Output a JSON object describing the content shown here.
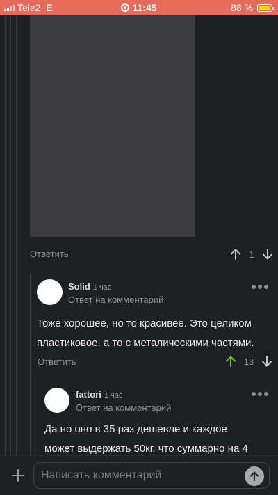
{
  "status_bar": {
    "carrier": "Tele2",
    "network": "E",
    "time": "11:45",
    "battery": "88 %",
    "battery_level": 0.88
  },
  "thread": {
    "top_post": {
      "reply_label": "Ответить",
      "vote_count": "1"
    },
    "comments": [
      {
        "author": "Solid",
        "time": "1 час",
        "subtitle": "Ответ на комментарий",
        "lines": [
          "Тоже хорошее, но то красивее. Это целиком",
          "пластиковое, а то с металическими частями."
        ],
        "reply_label": "Ответить",
        "vote_count": "13"
      },
      {
        "author": "fattori",
        "time": "1 час",
        "subtitle": "Ответ на комментарий",
        "lines": [
          "Да но оно в 35 раз дешевле и каждое",
          "может выдержать 50кг, что суммарно на 4"
        ]
      }
    ]
  },
  "composer": {
    "placeholder": "Написать комментарий"
  },
  "colors": {
    "status_bar": "#e66b5b",
    "background": "#1f2023",
    "upvote_active": "#6fbf3a",
    "muted": "#8d8f93"
  }
}
